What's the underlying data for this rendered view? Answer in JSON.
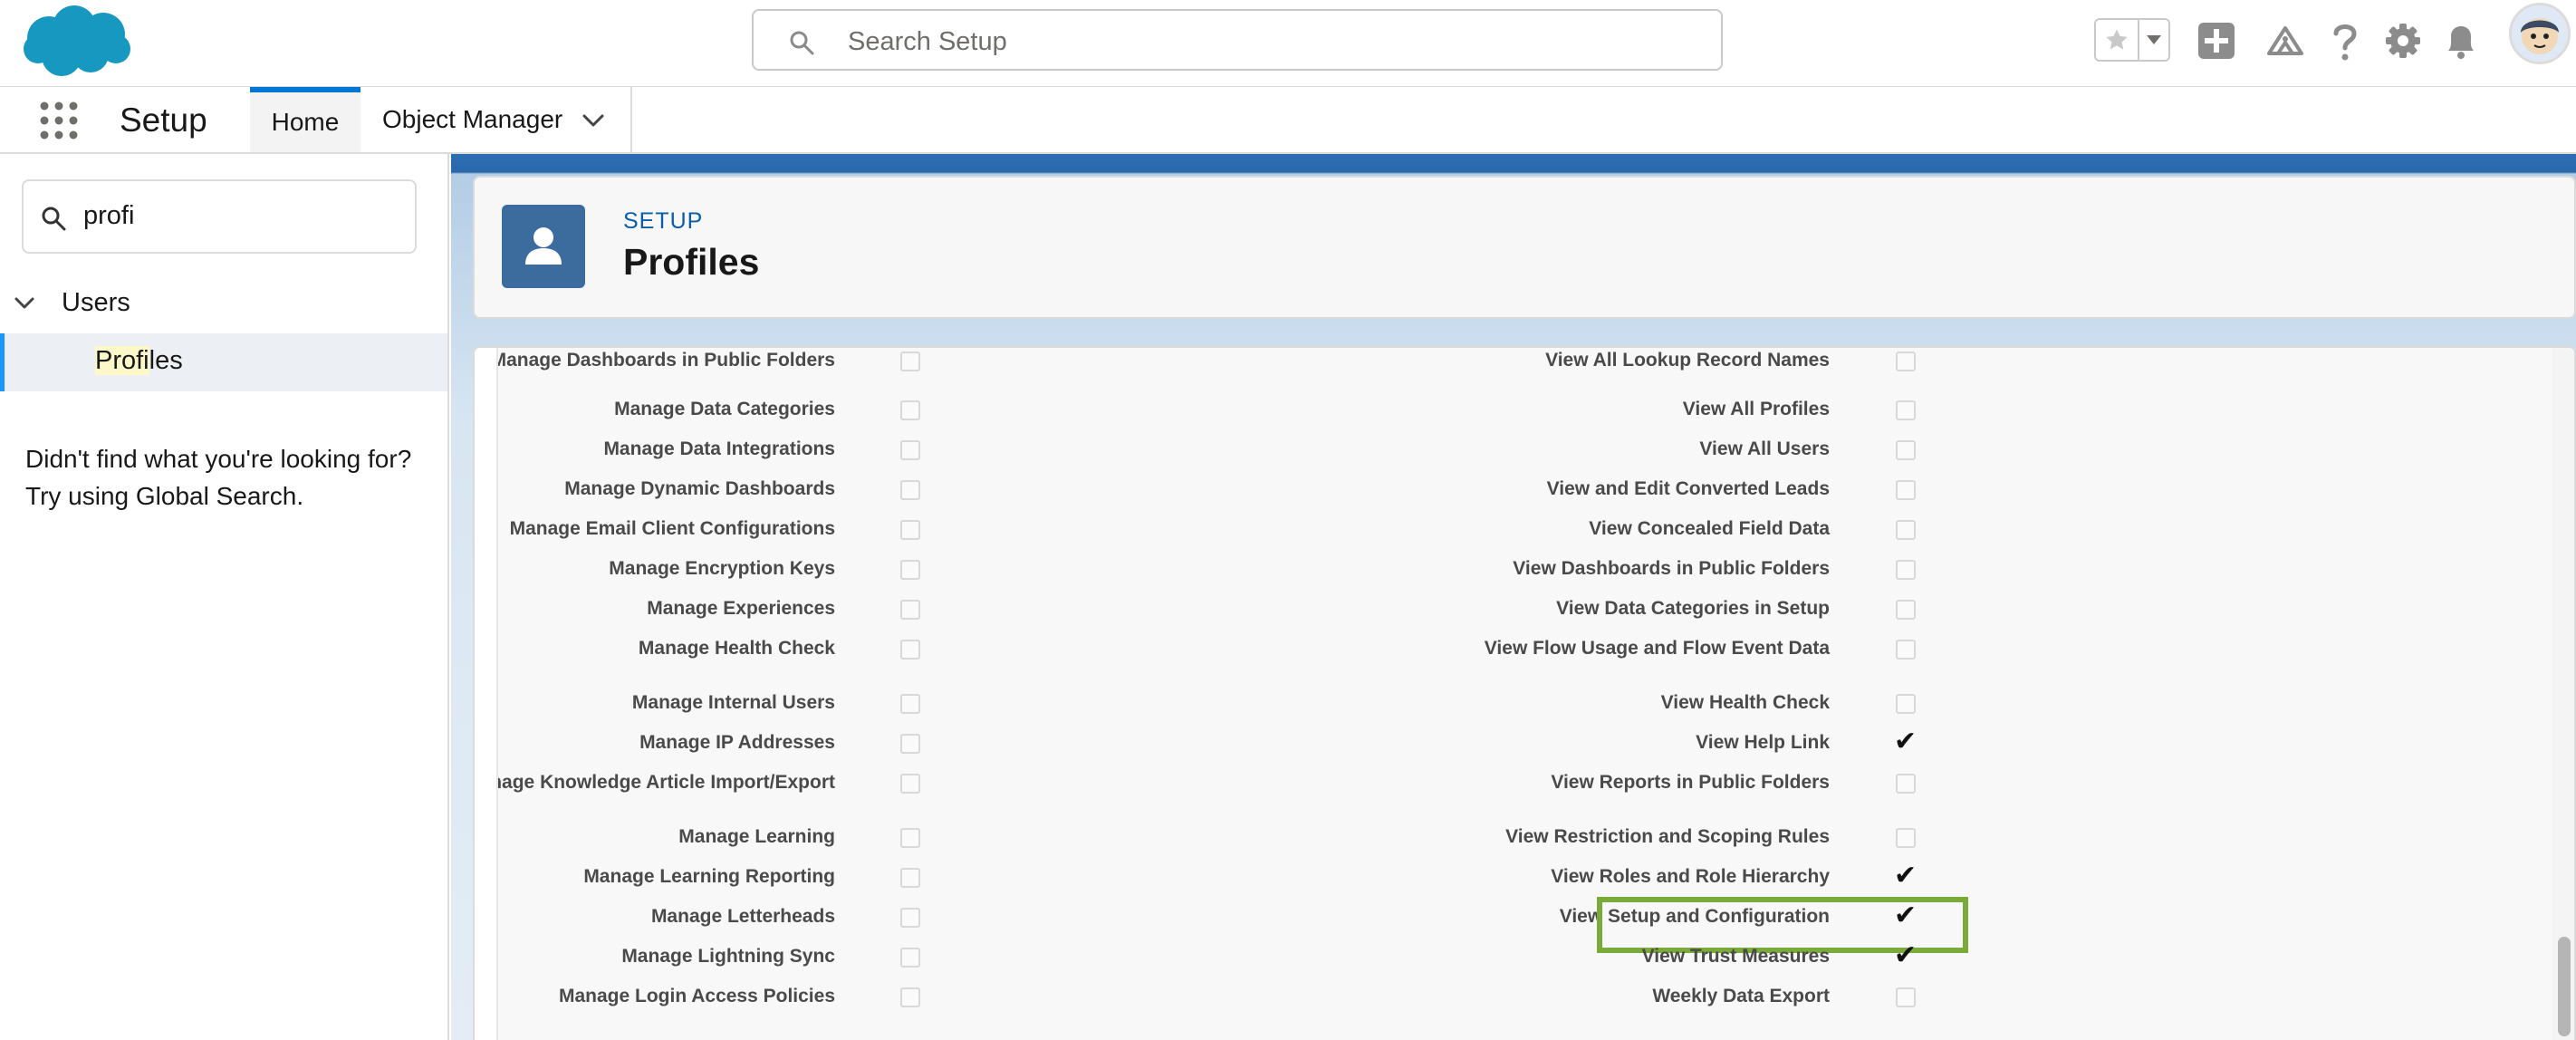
{
  "header": {
    "search_placeholder": "Search Setup"
  },
  "nav": {
    "app_name": "Setup",
    "tabs": [
      {
        "label": "Home",
        "active": true
      },
      {
        "label": "Object Manager",
        "active": false
      }
    ]
  },
  "sidebar": {
    "quick_find_value": "profi",
    "tree_group": "Users",
    "tree_item_highlight": "Profi",
    "tree_item_rest": "les",
    "not_found_line1": "Didn't find what you're looking for?",
    "not_found_line2": "Try using Global Search."
  },
  "page": {
    "eyebrow": "SETUP",
    "title": "Profiles"
  },
  "permissions": {
    "left": [
      {
        "label": "Manage Dashboards in Public Folders",
        "checked": false
      },
      {
        "label": "Manage Data Categories",
        "checked": false
      },
      {
        "label": "Manage Data Integrations",
        "checked": false
      },
      {
        "label": "Manage Dynamic Dashboards",
        "checked": false
      },
      {
        "label": "Manage Email Client Configurations",
        "checked": false
      },
      {
        "label": "Manage Encryption Keys",
        "checked": false
      },
      {
        "label": "Manage Experiences",
        "checked": false
      },
      {
        "label": "Manage Health Check",
        "checked": false
      },
      {
        "label": "Manage Internal Users",
        "checked": false
      },
      {
        "label": "Manage IP Addresses",
        "checked": false
      },
      {
        "label": "Manage Knowledge Article Import/Export",
        "checked": false
      },
      {
        "label": "Manage Learning",
        "checked": false
      },
      {
        "label": "Manage Learning Reporting",
        "checked": false
      },
      {
        "label": "Manage Letterheads",
        "checked": false
      },
      {
        "label": "Manage Lightning Sync",
        "checked": false
      },
      {
        "label": "Manage Login Access Policies",
        "checked": false
      }
    ],
    "right": [
      {
        "label": "View All Lookup Record Names",
        "checked": false
      },
      {
        "label": "View All Profiles",
        "checked": false
      },
      {
        "label": "View All Users",
        "checked": false
      },
      {
        "label": "View and Edit Converted Leads",
        "checked": false
      },
      {
        "label": "View Concealed Field Data",
        "checked": false
      },
      {
        "label": "View Dashboards in Public Folders",
        "checked": false
      },
      {
        "label": "View Data Categories in Setup",
        "checked": false
      },
      {
        "label": "View Flow Usage and Flow Event Data",
        "checked": false
      },
      {
        "label": "View Health Check",
        "checked": false
      },
      {
        "label": "View Help Link",
        "checked": true
      },
      {
        "label": "View Reports in Public Folders",
        "checked": false
      },
      {
        "label": "View Restriction and Scoping Rules",
        "checked": false
      },
      {
        "label": "View Roles and Role Hierarchy",
        "checked": true
      },
      {
        "label": "View Setup and Configuration",
        "checked": true,
        "highlighted": true
      },
      {
        "label": "View Trust Measures",
        "checked": true
      },
      {
        "label": "Weekly Data Export",
        "checked": false
      }
    ]
  },
  "colors": {
    "brand_blue": "#0176d3",
    "highlight_green": "#7aab3a",
    "page_icon_bg": "#3c6b9e"
  }
}
